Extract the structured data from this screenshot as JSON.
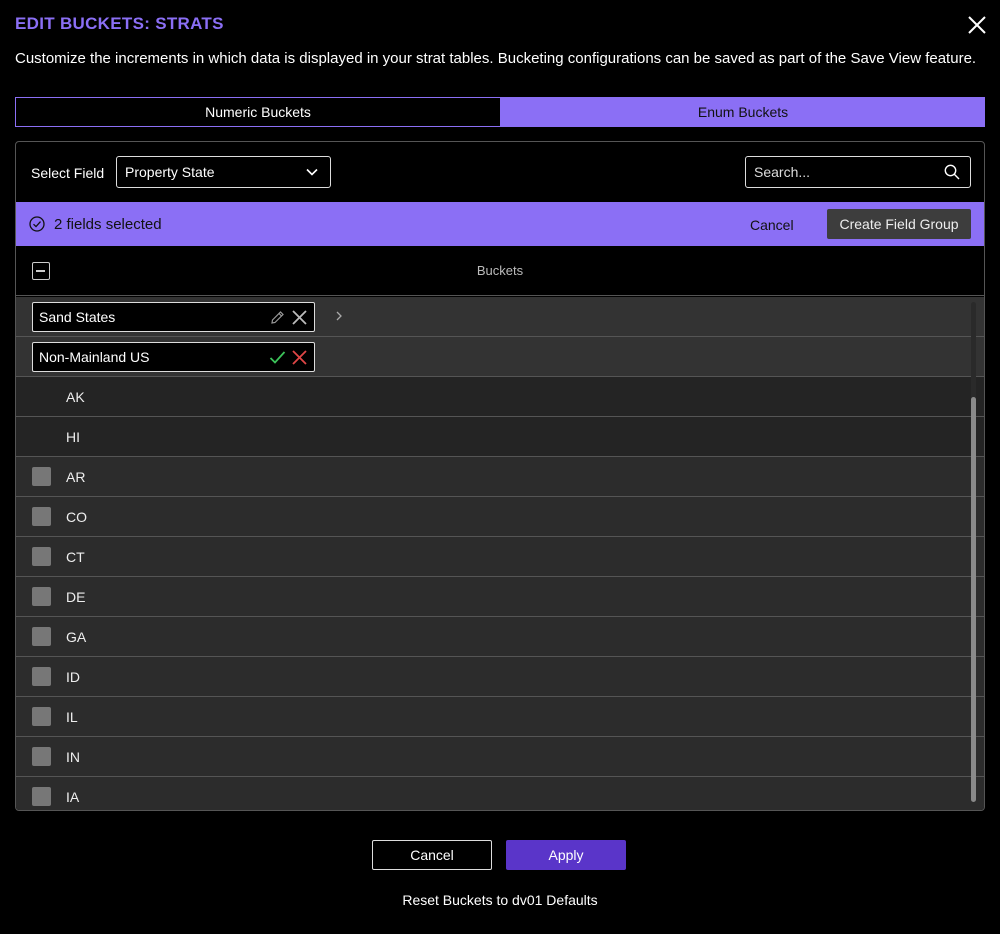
{
  "dialog": {
    "title": "EDIT BUCKETS: STRATS",
    "description": "Customize the increments in which data is displayed in your strat tables. Bucketing configurations can be saved as part of the Save View feature."
  },
  "tabs": [
    {
      "label": "Numeric Buckets",
      "active": false
    },
    {
      "label": "Enum Buckets",
      "active": true
    }
  ],
  "toolbar": {
    "select_label": "Select Field",
    "select_value": "Property State",
    "search_placeholder": "Search..."
  },
  "selection": {
    "count_text": "2 fields selected",
    "cancel_label": "Cancel",
    "create_label": "Create Field Group"
  },
  "table": {
    "header": "Buckets",
    "groups": [
      {
        "name": "Sand States",
        "mode": "view"
      },
      {
        "name": "Non-Mainland US",
        "mode": "edit"
      }
    ],
    "group_children": [
      "AK",
      "HI"
    ],
    "items": [
      "AR",
      "CO",
      "CT",
      "DE",
      "GA",
      "ID",
      "IL",
      "IN",
      "IA"
    ]
  },
  "footer": {
    "cancel_label": "Cancel",
    "apply_label": "Apply",
    "reset_label": "Reset Buckets to dv01 Defaults"
  },
  "colors": {
    "accent": "#8b6ff5",
    "apply": "#5a35c9",
    "confirm": "#3cc45a",
    "delete": "#e04646"
  }
}
